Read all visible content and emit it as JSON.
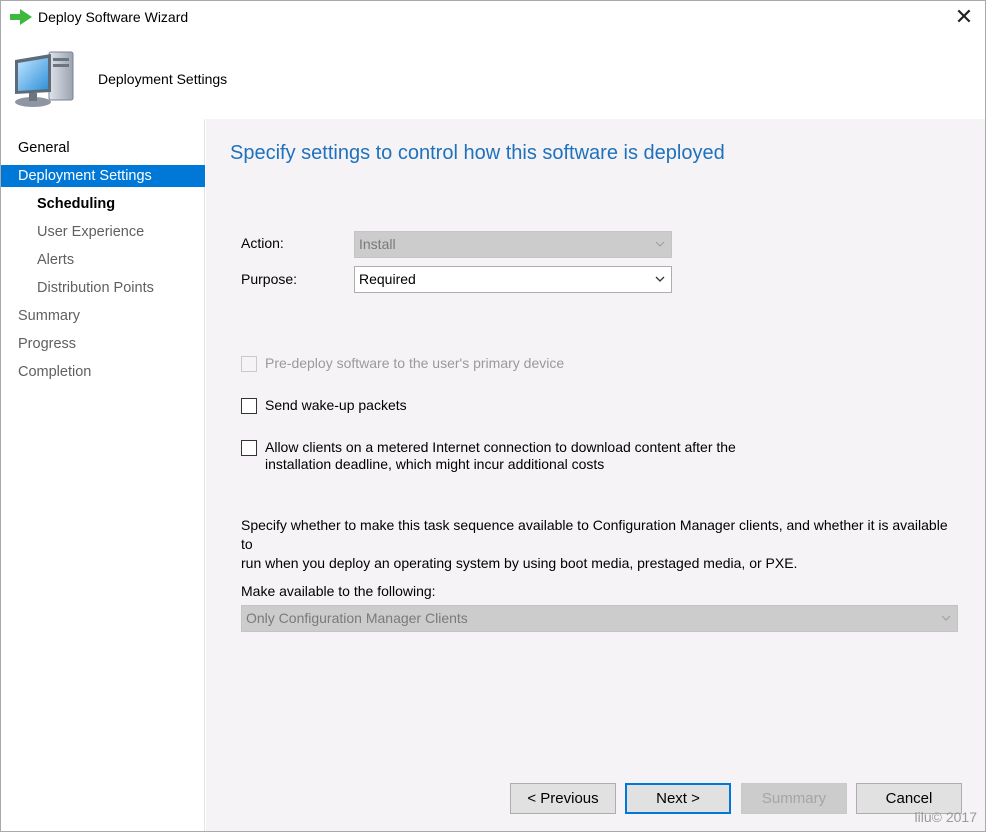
{
  "window": {
    "title": "Deploy Software Wizard",
    "close_glyph": "✕",
    "title_icon": "green-arrow-icon"
  },
  "header": {
    "text": "Deployment Settings",
    "icon": "computer-icon"
  },
  "sidebar": {
    "items": [
      {
        "label": "General",
        "state": "done"
      },
      {
        "label": "Deployment Settings",
        "state": "active"
      },
      {
        "label": "Scheduling",
        "state": "current"
      },
      {
        "label": "User Experience",
        "state": "pending"
      },
      {
        "label": "Alerts",
        "state": "pending"
      },
      {
        "label": "Distribution Points",
        "state": "pending"
      },
      {
        "label": "Summary",
        "state": "pending"
      },
      {
        "label": "Progress",
        "state": "pending"
      },
      {
        "label": "Completion",
        "state": "pending"
      }
    ]
  },
  "main": {
    "heading": "Specify settings to control how this software is deployed",
    "action": {
      "label": "Action:",
      "value": "Install",
      "enabled": false
    },
    "purpose": {
      "label": "Purpose:",
      "value": "Required",
      "enabled": true
    },
    "predeploy": {
      "label": "Pre-deploy software to the user's primary device",
      "checked": false,
      "enabled": false
    },
    "wakeup": {
      "label": "Send wake-up packets",
      "checked": false,
      "enabled": true
    },
    "metered": {
      "line1": "Allow clients on a metered Internet connection to download content after the",
      "line2": "installation deadline, which might incur additional costs",
      "checked": false,
      "enabled": true
    },
    "info_line1": "Specify whether to make this task sequence available to Configuration Manager clients, and whether it is available to",
    "info_line2": "run when you deploy an operating system by using boot media, prestaged media, or PXE.",
    "available": {
      "label": "Make available to the following:",
      "value": "Only Configuration Manager Clients",
      "enabled": false
    }
  },
  "buttons": {
    "previous": "< Previous",
    "next": "Next >",
    "summary": "Summary",
    "cancel": "Cancel"
  },
  "watermark": "lilu© 2017",
  "colors": {
    "accent": "#0078d7",
    "heading": "#1e72bd",
    "content_bg": "#f6f3f6"
  }
}
